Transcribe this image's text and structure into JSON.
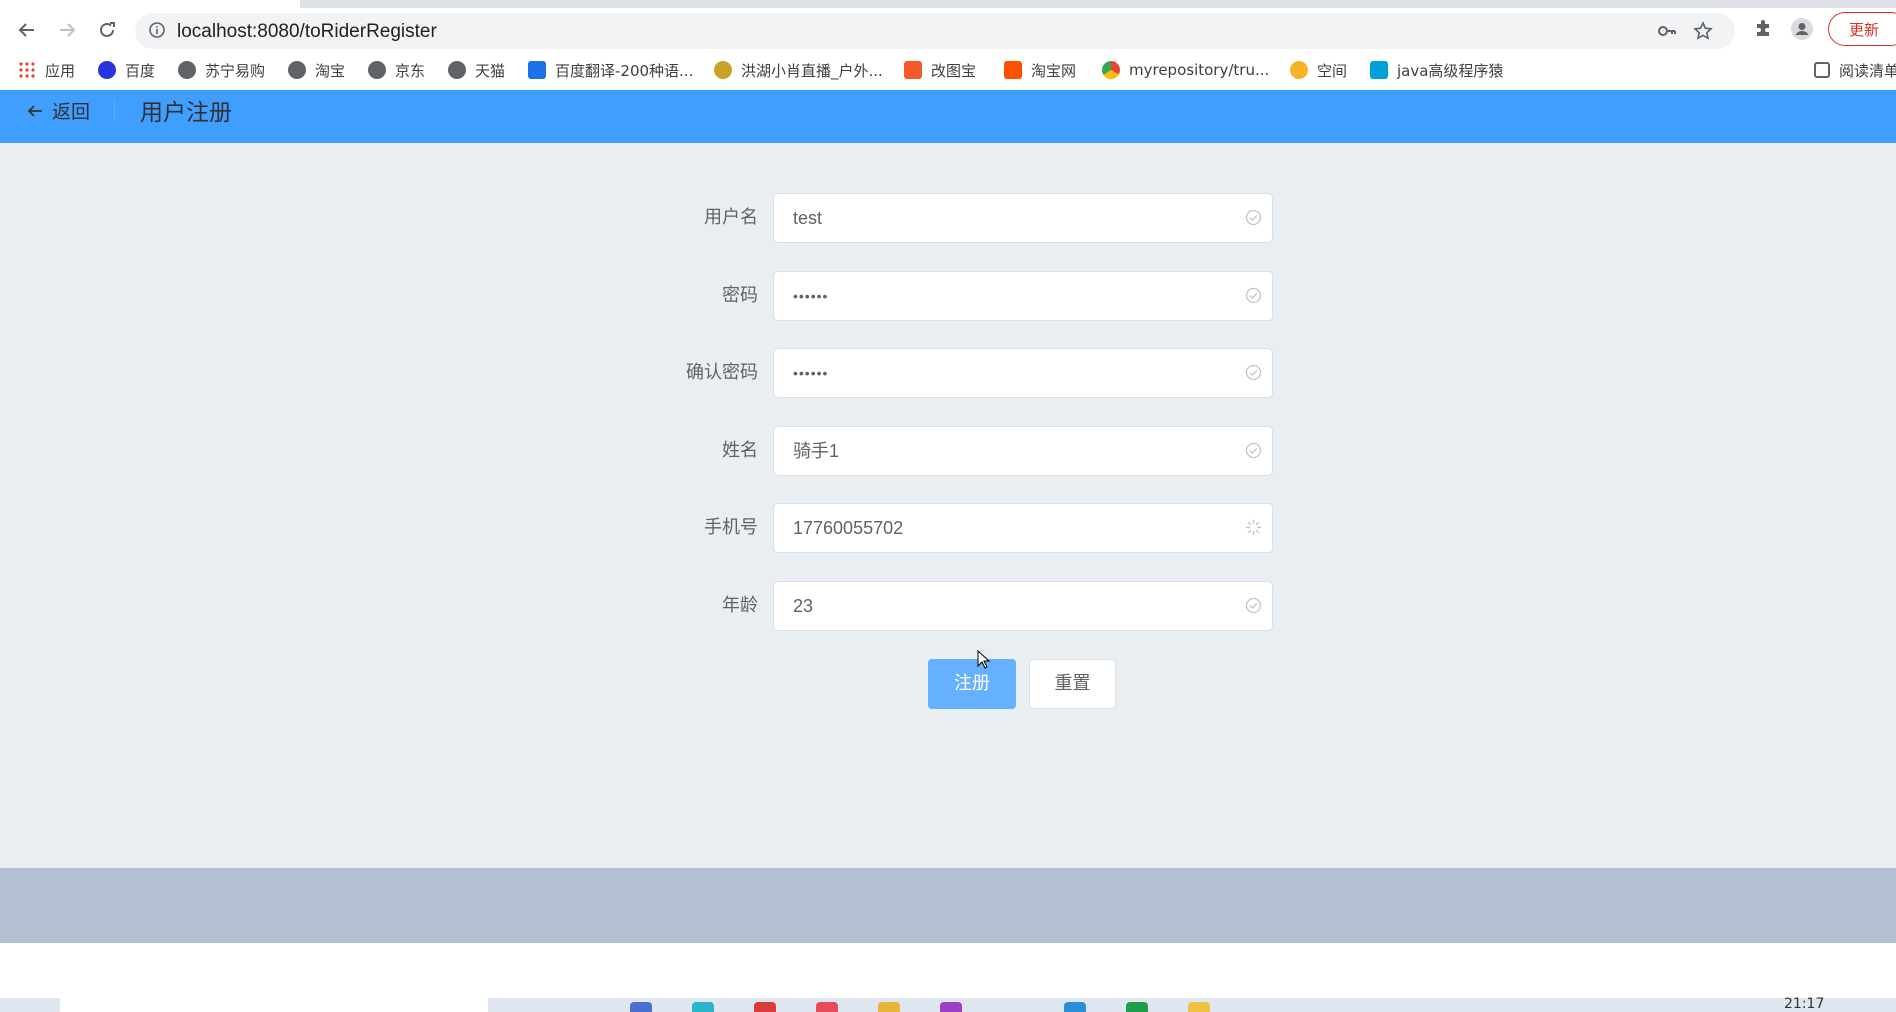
{
  "browser": {
    "url": "localhost:8080/toRiderRegister",
    "update_label": "更新",
    "bookmarks": [
      {
        "label": "应用",
        "icon": "apps-grid-icon"
      },
      {
        "label": "百度",
        "icon": "baidu-paw-icon"
      },
      {
        "label": "苏宁易购",
        "icon": "globe-icon"
      },
      {
        "label": "淘宝",
        "icon": "globe-icon"
      },
      {
        "label": "京东",
        "icon": "globe-icon"
      },
      {
        "label": "天猫",
        "icon": "globe-icon"
      },
      {
        "label": "百度翻译-200种语...",
        "icon": "translate-icon"
      },
      {
        "label": "洪湖小肖直播_户外...",
        "icon": "bird-icon"
      },
      {
        "label": "改图宝",
        "icon": "image-tool-icon"
      },
      {
        "label": "淘宝网",
        "icon": "taobao-icon"
      },
      {
        "label": "myrepository/tru...",
        "icon": "chrome-icon"
      },
      {
        "label": "空间",
        "icon": "qzone-icon"
      },
      {
        "label": "java高级程序猿",
        "icon": "bilibili-icon"
      },
      {
        "label": "阅读清单",
        "icon": "reading-list-icon"
      }
    ]
  },
  "header": {
    "back_label": "返回",
    "title": "用户注册"
  },
  "form": {
    "fields": [
      {
        "label": "用户名",
        "value": "test",
        "status": "valid"
      },
      {
        "label": "密码",
        "value": "••••••",
        "status": "valid"
      },
      {
        "label": "确认密码",
        "value": "••••••",
        "status": "valid"
      },
      {
        "label": "姓名",
        "value": "骑手1",
        "status": "valid"
      },
      {
        "label": "手机号",
        "value": "17760055702",
        "status": "validating"
      },
      {
        "label": "年龄",
        "value": "23",
        "status": "valid"
      }
    ],
    "register_label": "注册",
    "reset_label": "重置"
  },
  "taskbar": {
    "clock": "21:17"
  },
  "colors": {
    "header": "#409eff",
    "body": "#e9eef3",
    "footer": "#b3c0d1",
    "primary_button": "#66b1ff"
  }
}
